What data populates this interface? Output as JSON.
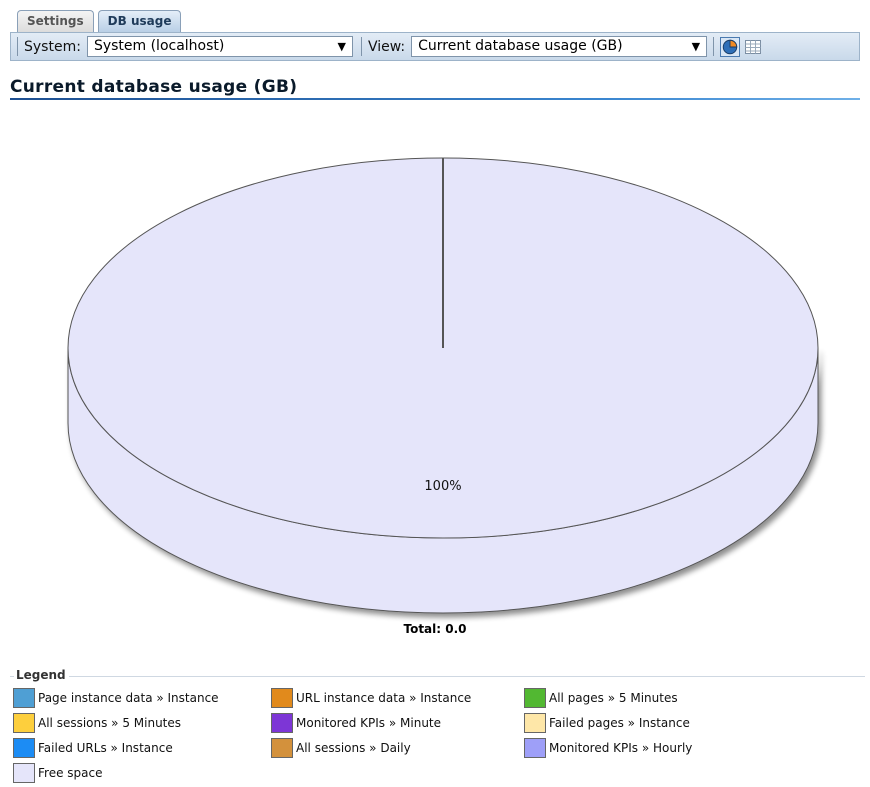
{
  "tabs": [
    {
      "label": "Settings",
      "active": false
    },
    {
      "label": "DB usage",
      "active": true
    }
  ],
  "toolbar": {
    "system_label": "System:",
    "system_value": "System (localhost)",
    "view_label": "View:",
    "view_value": "Current database usage (GB)",
    "icons": [
      "pie-chart-icon",
      "table-view-icon"
    ]
  },
  "heading": "Current database usage (GB)",
  "chart_data": {
    "type": "pie",
    "title": "Current database usage (GB)",
    "slices": [
      {
        "label": "Free space",
        "percent": 100,
        "label_text": "100%",
        "color": "#e5e5fa"
      }
    ],
    "total_label": "Total: 0.0",
    "three_d": true
  },
  "legend": {
    "title": "Legend",
    "items": [
      {
        "label": "Page instance data » Instance",
        "color": "#4f9fd4"
      },
      {
        "label": "URL instance data » Instance",
        "color": "#e18a1c"
      },
      {
        "label": "All pages » 5 Minutes",
        "color": "#52b832"
      },
      {
        "label": "All sessions » 5 Minutes",
        "color": "#fdcf3d"
      },
      {
        "label": "Monitored KPIs » Minute",
        "color": "#7d36d6"
      },
      {
        "label": "Failed pages » Instance",
        "color": "#fee7a8"
      },
      {
        "label": "Failed URLs » Instance",
        "color": "#1c8cf4"
      },
      {
        "label": "All sessions » Daily",
        "color": "#d3913c"
      },
      {
        "label": "Monitored KPIs » Hourly",
        "color": "#9e9ff8"
      },
      {
        "label": "Free space",
        "color": "#e5e5fa"
      }
    ]
  }
}
